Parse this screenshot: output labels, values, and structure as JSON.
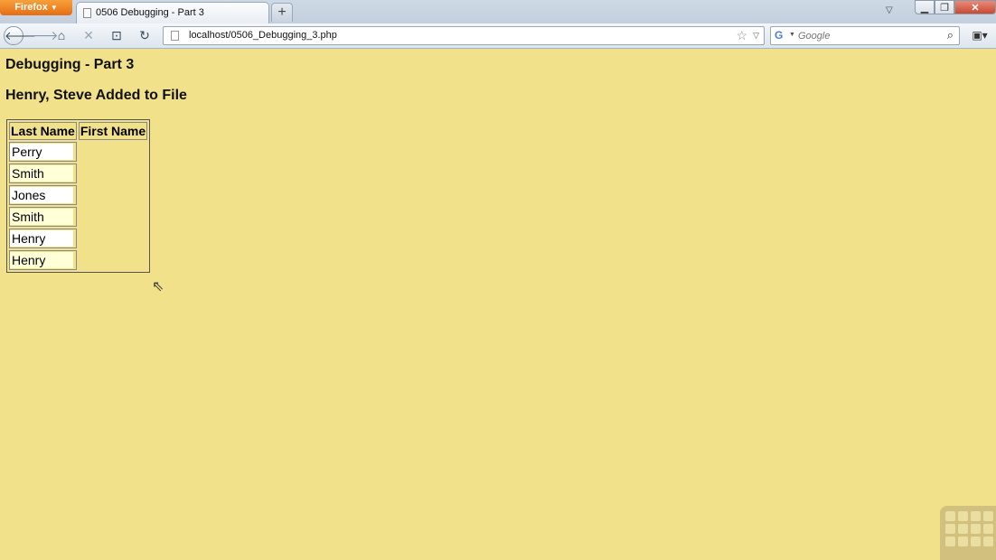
{
  "browser": {
    "menu_label": "Firefox",
    "tab_title": "0506 Debugging - Part 3",
    "new_tab_label": "+",
    "url": "localhost/0506_Debugging_3.php",
    "search_placeholder": "Google",
    "icons": [
      "back-icon",
      "forward-icon",
      "home-icon",
      "stop-icon",
      "save-icon",
      "reload-icon",
      "bookmark-star-icon",
      "search-icon"
    ]
  },
  "page": {
    "title": "Debugging - Part 3",
    "subtitle": "Henry, Steve Added to File"
  },
  "table": {
    "headers": [
      "Last Name",
      "First Name"
    ],
    "rows": [
      {
        "last_name": "Perry",
        "first_name": ""
      },
      {
        "last_name": "Smith",
        "first_name": ""
      },
      {
        "last_name": "Jones",
        "first_name": ""
      },
      {
        "last_name": "Smith",
        "first_name": ""
      },
      {
        "last_name": "Henry",
        "first_name": ""
      },
      {
        "last_name": "Henry",
        "first_name": ""
      }
    ]
  },
  "colors": {
    "page_background": "#f0e18a",
    "input_background": "#ffffff",
    "alt_input_background": "#ffffd8"
  }
}
